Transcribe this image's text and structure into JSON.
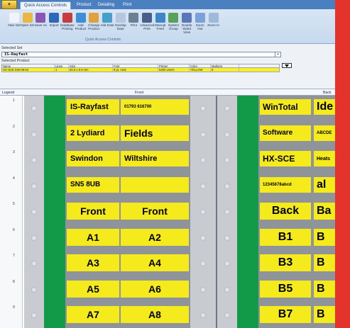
{
  "app": {
    "menu_glyph": "▾"
  },
  "tabs": [
    "Quick Access Controls",
    "Product",
    "Detailing",
    "Print"
  ],
  "toolbar": {
    "buttons": [
      {
        "label": "New Set",
        "icon": "new-set-icon"
      },
      {
        "label": "Open Set",
        "icon": "open-set-icon"
      },
      {
        "label": "Save As",
        "icon": "save-as-icon"
      },
      {
        "label": "Import",
        "icon": "import-icon"
      },
      {
        "label": "Database Printing",
        "icon": "database-printing-icon"
      },
      {
        "label": "Add Product",
        "icon": "add-product-icon"
      },
      {
        "label": "Change Product",
        "icon": "change-product-icon"
      },
      {
        "label": "Add Date",
        "icon": "add-date-icon"
      },
      {
        "label": "Overlap Data",
        "icon": "overlap-data-icon"
      },
      {
        "label": "Print",
        "icon": "print-icon"
      },
      {
        "label": "Advanced Print",
        "icon": "advanced-print-icon"
      },
      {
        "label": "Manual Feed",
        "icon": "manual-feed-icon"
      },
      {
        "label": "System Group",
        "icon": "system-group-icon"
      },
      {
        "label": "Double Sided View",
        "icon": "double-sided-view-icon"
      },
      {
        "label": "Zoom Out",
        "icon": "zoom-out-icon"
      },
      {
        "label": "Zoom In",
        "icon": "zoom-in-icon"
      }
    ],
    "group_caption": "Quick Access Controls"
  },
  "selected_set": {
    "label": "Selected Set",
    "value": "IS-Rayfast",
    "dropdown_arrow": "▾"
  },
  "selected_product": {
    "label": "Selected Product",
    "columns": [
      "Name",
      "Lines",
      "Size",
      "Font",
      "Printer",
      "Color",
      "Markers"
    ],
    "row": [
      "HX-SCE 040-08-53",
      "1",
      "50.0 x 8.0 mm",
      "8 pt. Arial",
      "5200 Users",
      "YELLOW",
      "9"
    ]
  },
  "legend": {
    "label": "Legend",
    "front": "Front",
    "back": "Back"
  },
  "rows": [
    "1",
    "2",
    "3",
    "4",
    "5",
    "6",
    "7",
    "8",
    "9"
  ],
  "front_markers": [
    [
      "IS-Rayfast",
      "01793 616700"
    ],
    [
      "2 Lydiard",
      "Fields"
    ],
    [
      "Swindon",
      "Wiltshire"
    ],
    [
      "SN5 8UB",
      ""
    ],
    [
      "Front",
      "Front"
    ],
    [
      "A1",
      "A2"
    ],
    [
      "A3",
      "A4"
    ],
    [
      "A5",
      "A6"
    ],
    [
      "A7",
      "A8"
    ]
  ],
  "back_markers": [
    [
      "WinTotal",
      "Ide"
    ],
    [
      "Software",
      "ABCDE"
    ],
    [
      "HX-SCE",
      "Heats"
    ],
    [
      "12345678abcd",
      "al"
    ],
    [
      "Back",
      "Ba"
    ],
    [
      "B1",
      "B"
    ],
    [
      "B3",
      "B"
    ],
    [
      "B5",
      "B"
    ],
    [
      "B7",
      "B"
    ]
  ],
  "colors": {
    "marker_yellow": "#f4ea1c",
    "strip_green": "#129a48",
    "product_row": "#f6f02a",
    "ribbon_blue": "#4a7fc0",
    "side_red": "#e4332a"
  }
}
